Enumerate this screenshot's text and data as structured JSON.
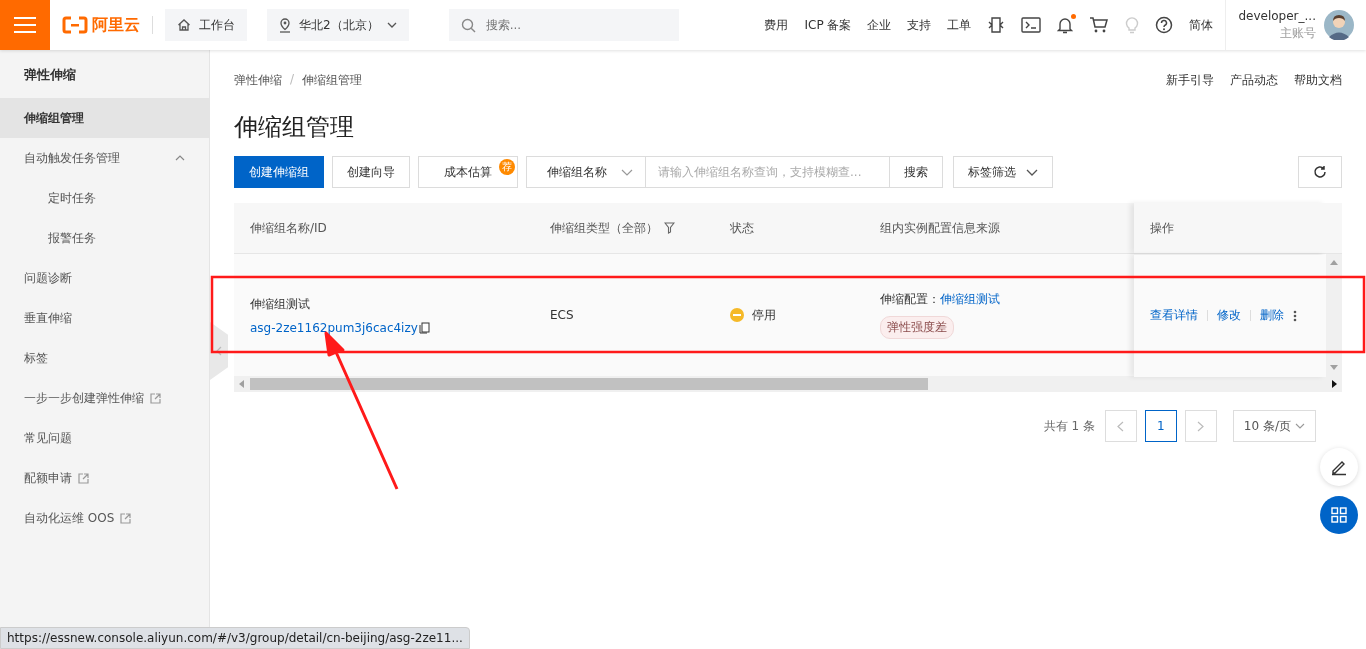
{
  "topbar": {
    "logo": "阿里云",
    "workbench": "工作台",
    "region": "华北2（北京）",
    "search": {
      "placeholder": "搜索..."
    },
    "nav": [
      "费用",
      "ICP 备案",
      "企业",
      "支持",
      "工单"
    ],
    "notification_dot": true,
    "language": "简体",
    "user": {
      "name": "developer_...",
      "account": "主账号"
    }
  },
  "sidebar": {
    "title": "弹性伸缩",
    "items": [
      {
        "label": "伸缩组管理",
        "kind": "link",
        "selected": true
      },
      {
        "label": "自动触发任务管理",
        "kind": "group",
        "selected": false,
        "expanded": true,
        "children": [
          {
            "label": "定时任务",
            "selected": false
          },
          {
            "label": "报警任务",
            "selected": false
          }
        ]
      },
      {
        "label": "问题诊断",
        "kind": "link",
        "selected": false
      },
      {
        "label": "垂直伸缩",
        "kind": "link",
        "selected": false
      },
      {
        "label": "标签",
        "kind": "link",
        "selected": false
      },
      {
        "label": "一步一步创建弹性伸缩",
        "kind": "external",
        "selected": false
      },
      {
        "label": "常见问题",
        "kind": "link",
        "selected": false
      },
      {
        "label": "配额申请",
        "kind": "external",
        "selected": false
      },
      {
        "label": "自动化运维 OOS",
        "kind": "external",
        "selected": false
      }
    ]
  },
  "breadcrumb": [
    "弹性伸缩",
    "伸缩组管理"
  ],
  "breadcrumb_separator": "/",
  "help_links": [
    "新手引导",
    "产品动态",
    "帮助文档"
  ],
  "title": "伸缩组管理",
  "toolbar": {
    "buttons": [
      {
        "label": "创建伸缩组",
        "kind": "primary"
      },
      {
        "label": "创建向导",
        "kind": "normal"
      },
      {
        "label": "成本估算",
        "kind": "badge",
        "badge": "荐"
      }
    ],
    "search_by": "伸缩组名称",
    "search": {
      "placeholder": "请输入伸缩组名称查询，支持模糊查..."
    },
    "search_button": "搜索",
    "tag_filter": "标签筛选"
  },
  "table": {
    "columns": [
      {
        "label": "伸缩组名称/ID"
      },
      {
        "label": "伸缩组类型（全部）",
        "filter": true
      },
      {
        "label": "状态"
      },
      {
        "label": "组内实例配置信息来源"
      },
      {
        "label": "操作"
      }
    ],
    "rows": [
      {
        "name": "伸缩组测试",
        "id": "asg-2ze1162pum3j6cac4izy",
        "type": "ECS",
        "status": {
          "label": "停用",
          "color": "#f5b928"
        },
        "config_label": "伸缩配置：",
        "config_link": "伸缩组测试",
        "tag": "弹性强度差",
        "actions": [
          "查看详情",
          "修改",
          "删除"
        ]
      }
    ]
  },
  "pagination": {
    "total": "共有 1 条",
    "pages": [
      {
        "label": "1",
        "selected": true
      }
    ],
    "page_size": "10 条/页"
  },
  "status_bar": "https://essnew.console.aliyun.com/#/v3/group/detail/cn-beijing/asg-2ze11..."
}
